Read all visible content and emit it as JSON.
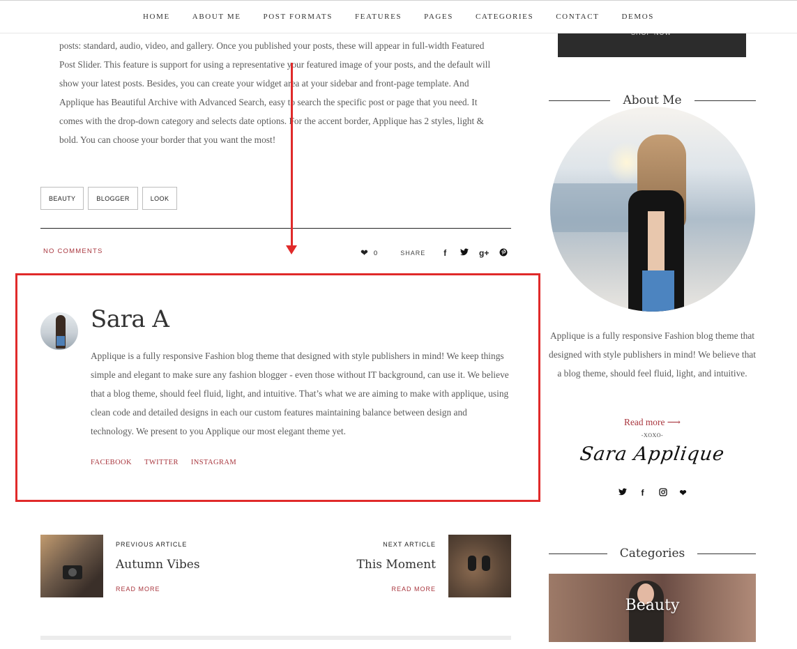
{
  "nav": {
    "items": [
      "HOME",
      "ABOUT ME",
      "POST FORMATS",
      "FEATURES",
      "PAGES",
      "CATEGORIES",
      "CONTACT",
      "DEMOS"
    ]
  },
  "post": {
    "text": "posts: standard, audio, video, and gallery. Once you published your posts, these will appear in full-width Featured Post Slider. This feature is support for using a representative your featured image of your posts, and the default will show your latest posts. Besides, you can create your widget area at your sidebar and front-page template. And Applique has Beautiful Archive with Advanced Search, easy to search the specific post or page that you need. It comes with the drop-down category and selects date options. For the accent border, Applique has 2 styles, light & bold. You can choose your border that you want the most!",
    "tags": [
      "BEAUTY",
      "BLOGGER",
      "LOOK"
    ],
    "comments_label": "NO COMMENTS",
    "likes_count": "0",
    "share_label": "SHARE"
  },
  "author": {
    "name": "Sara A",
    "bio": "Applique is a fully responsive Fashion blog theme that designed with style publishers in mind! We keep things simple and elegant to make sure any fashion blogger - even those without IT background, can use it. We believe that a blog theme, should feel fluid, light, and intuitive. That’s what we are aiming to make with applique, using clean code and detailed designs in each our custom features maintaining balance between design and technology. We present to you Applique our most elegant theme yet.",
    "links": [
      "FACEBOOK",
      "TWITTER",
      "INSTAGRAM"
    ]
  },
  "post_nav": {
    "previous": {
      "kicker": "PREVIOUS ARTICLE",
      "title": "Autumn Vibes",
      "read_more": "READ MORE"
    },
    "next": {
      "kicker": "NEXT ARTICLE",
      "title": "This Moment",
      "read_more": "READ MORE"
    }
  },
  "sidebar": {
    "shop_banner": "SHOP NOW",
    "about": {
      "title": "About Me",
      "text": "Applique is a fully responsive Fashion blog theme that designed with style publishers in mind! We believe that a blog theme, should feel fluid, light, and intuitive.",
      "read_more": "Read more ⟶",
      "xoxo": "-XOXO-",
      "signature": "Sara Applique"
    },
    "categories": {
      "title": "Categories",
      "tile_label": "Beauty"
    }
  },
  "colors": {
    "accent": "#a8353d",
    "annotation": "#e02a2a"
  },
  "icons": [
    "heart-icon",
    "facebook-icon",
    "twitter-icon",
    "google-plus-icon",
    "pinterest-icon",
    "instagram-icon"
  ]
}
